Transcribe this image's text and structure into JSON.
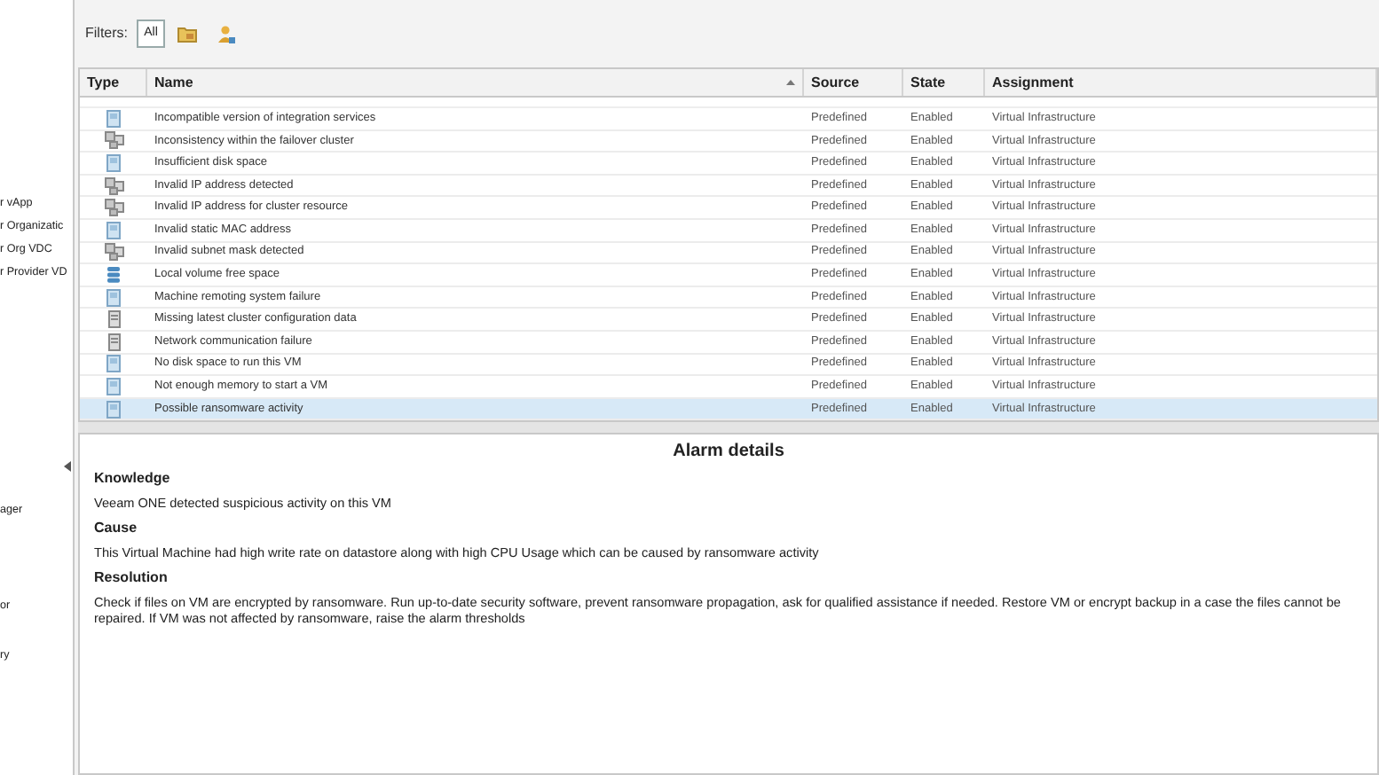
{
  "sidebar": {
    "items": [
      {
        "label": "r vApp"
      },
      {
        "label": "r Organizatic"
      },
      {
        "label": "r Org VDC"
      },
      {
        "label": "r Provider VD"
      },
      {
        "label": "ager"
      },
      {
        "label": "or"
      },
      {
        "label": "ry"
      }
    ]
  },
  "filters": {
    "label": "Filters:",
    "buttons": [
      {
        "kind": "text",
        "label": "All",
        "selected": true
      },
      {
        "kind": "folder",
        "selected": false
      },
      {
        "kind": "user",
        "selected": false
      }
    ]
  },
  "table": {
    "columns": [
      {
        "label": "Type"
      },
      {
        "label": "Name",
        "sorted": true
      },
      {
        "label": "Source"
      },
      {
        "label": "State"
      },
      {
        "label": "Assignment"
      }
    ],
    "rows": [
      {
        "kind": "vm",
        "name": "Incompatible version of integration services",
        "source": "Predefined",
        "state": "Enabled",
        "assignment": "Virtual Infrastructure",
        "selected": false
      },
      {
        "kind": "cluster",
        "name": "Inconsistency within the failover cluster",
        "source": "Predefined",
        "state": "Enabled",
        "assignment": "Virtual Infrastructure",
        "selected": false
      },
      {
        "kind": "vm",
        "name": "Insufficient disk space",
        "source": "Predefined",
        "state": "Enabled",
        "assignment": "Virtual Infrastructure",
        "selected": false
      },
      {
        "kind": "cluster",
        "name": "Invalid IP address detected",
        "source": "Predefined",
        "state": "Enabled",
        "assignment": "Virtual Infrastructure",
        "selected": false
      },
      {
        "kind": "cluster",
        "name": "Invalid IP address for cluster resource",
        "source": "Predefined",
        "state": "Enabled",
        "assignment": "Virtual Infrastructure",
        "selected": false
      },
      {
        "kind": "vm",
        "name": "Invalid static MAC address",
        "source": "Predefined",
        "state": "Enabled",
        "assignment": "Virtual Infrastructure",
        "selected": false
      },
      {
        "kind": "cluster",
        "name": "Invalid subnet mask detected",
        "source": "Predefined",
        "state": "Enabled",
        "assignment": "Virtual Infrastructure",
        "selected": false
      },
      {
        "kind": "datastore",
        "name": "Local volume free space",
        "source": "Predefined",
        "state": "Enabled",
        "assignment": "Virtual Infrastructure",
        "selected": false
      },
      {
        "kind": "vm",
        "name": "Machine remoting system failure",
        "source": "Predefined",
        "state": "Enabled",
        "assignment": "Virtual Infrastructure",
        "selected": false
      },
      {
        "kind": "host",
        "name": "Missing latest cluster configuration data",
        "source": "Predefined",
        "state": "Enabled",
        "assignment": "Virtual Infrastructure",
        "selected": false
      },
      {
        "kind": "host",
        "name": "Network communication failure",
        "source": "Predefined",
        "state": "Enabled",
        "assignment": "Virtual Infrastructure",
        "selected": false
      },
      {
        "kind": "vm",
        "name": "No disk space to run this VM",
        "source": "Predefined",
        "state": "Enabled",
        "assignment": "Virtual Infrastructure",
        "selected": false
      },
      {
        "kind": "vm",
        "name": "Not enough memory to start a VM",
        "source": "Predefined",
        "state": "Enabled",
        "assignment": "Virtual Infrastructure",
        "selected": false
      },
      {
        "kind": "vm",
        "name": "Possible ransomware activity",
        "source": "Predefined",
        "state": "Enabled",
        "assignment": "Virtual Infrastructure",
        "selected": true
      }
    ]
  },
  "details": {
    "title": "Alarm details",
    "sections": [
      {
        "heading": "Knowledge",
        "text": "Veeam ONE detected suspicious activity on this VM"
      },
      {
        "heading": "Cause",
        "text": "This Virtual Machine had high write rate on datastore along with high CPU Usage which can be caused by ransomware activity"
      },
      {
        "heading": "Resolution",
        "text": "Check if files on VM are encrypted by ransomware. Run up-to-date security software, prevent ransomware propagation, ask for qualified assistance if needed. Restore VM or encrypt backup in a case the files cannot be repaired. If VM was not affected by ransomware, raise the alarm thresholds"
      }
    ]
  }
}
